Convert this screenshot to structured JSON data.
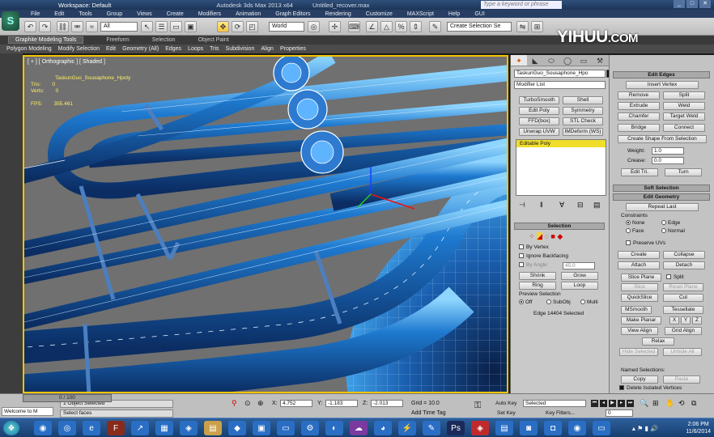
{
  "titlebar": {
    "workspace": "Workspace: Default",
    "title": "Autodesk 3ds Max 2013 x64",
    "file": "Untitled_recover.max",
    "search_placeholder": "Type a keyword or phrase"
  },
  "menu": [
    "File",
    "Edit",
    "Tools",
    "Group",
    "Views",
    "Create",
    "Modifiers",
    "Animation",
    "Graph Editors",
    "Rendering",
    "Customize",
    "MAXScript",
    "Help",
    "GUI"
  ],
  "toolbar": {
    "filter": "All",
    "coord": "World",
    "selset": "Create Selection Se"
  },
  "ribbon": {
    "tabs": [
      "Graphite Modeling Tools",
      "Freeform",
      "Selection",
      "Object Paint"
    ],
    "subtabs": [
      "Polygon Modeling",
      "Modify Selection",
      "Edit",
      "Geometry (All)",
      "Edges",
      "Loops",
      "Tris",
      "Subdivision",
      "Align",
      "Properties"
    ]
  },
  "watermark": {
    "main": "YIHUU",
    "dom": ".COM"
  },
  "viewport": {
    "label": "[ + ] [ Orthographic ] [ Shaded ]",
    "object": "TaskunGuo_Sousaphone_Hpoly",
    "stats": [
      {
        "k": "Tris:",
        "v": "0"
      },
      {
        "k": "Verts:",
        "v": "0"
      }
    ],
    "fps_label": "FPS:",
    "fps": "355.461"
  },
  "cmd": {
    "objname": "TaskunGuo_Sousaphone_Hpo",
    "modlist": "Modifier List",
    "buttons": [
      "TurboSmooth",
      "Shell",
      "Edit Poly",
      "Symmetry",
      "FFD(box)",
      "STL Check",
      "Unwrap UVW",
      "IMDeform (WS)"
    ],
    "stack_item": "Editable Poly",
    "selection_title": "Selection",
    "by_vertex": "By Vertex",
    "ignore_backfacing": "Ignore Backfacing",
    "by_angle": "By Angle:",
    "angle": "45.0",
    "shrink": "Shrink",
    "grow": "Grow",
    "ring": "Ring",
    "loop": "Loop",
    "preview": "Preview Selection",
    "off": "Off",
    "subobj": "SubObj",
    "multi": "Multi",
    "status": "Edge 14404 Selected"
  },
  "edit_edges": {
    "title": "Edit Edges",
    "insert_vertex": "Insert Vertex",
    "remove": "Remove",
    "split": "Split",
    "extrude": "Extrude",
    "weld": "Weld",
    "chamfer": "Chamfer",
    "target_weld": "Target Weld",
    "bridge": "Bridge",
    "connect": "Connect",
    "create_shape": "Create Shape From Selection",
    "weight_label": "Weight:",
    "weight": "1.0",
    "crease_label": "Crease:",
    "crease": "0.0",
    "edit_tri": "Edit Tri.",
    "turn": "Turn"
  },
  "soft_selection": "Soft Selection",
  "edit_geometry": {
    "title": "Edit Geometry",
    "repeat_last": "Repeat Last",
    "constraints": "Constraints",
    "none": "None",
    "edge": "Edge",
    "face": "Face",
    "normal": "Normal",
    "preserve_uvs": "Preserve UVs",
    "create": "Create",
    "collapse": "Collapse",
    "attach": "Attach",
    "detach": "Detach",
    "slice_plane": "Slice Plane",
    "split": "Split",
    "slice": "Slice",
    "reset_plane": "Reset Plane",
    "quickslice": "QuickSlice",
    "cut": "Cut",
    "msmooth": "MSmooth",
    "tessellate": "Tessellate",
    "make_planar": "Make Planar",
    "x": "X",
    "y": "Y",
    "z": "Z",
    "view_align": "View Align",
    "grid_align": "Grid Align",
    "relax": "Relax",
    "hide_sel": "Hide Selected",
    "unhide_all": "Unhide All",
    "named_sel": "Named Selections:",
    "copy": "Copy",
    "paste": "Paste",
    "delete_iso": "Delete Isolated Vertices"
  },
  "status": {
    "slider": "0 / 100",
    "selected": "1 Object Selected",
    "prompt": "Select faces",
    "x": "4.752",
    "y": "-1.183",
    "z": "-2.013",
    "grid": "Grid = 10.0",
    "add_time_tag": "Add Time Tag",
    "auto_key": "Auto Key",
    "set_key": "Set Key",
    "selected_opt": "Selected",
    "key_filters": "Key Filters...",
    "frame": "0",
    "welcome": "Welcome to M"
  },
  "clock": {
    "time": "2:06 PM",
    "date": "11/6/2014"
  }
}
